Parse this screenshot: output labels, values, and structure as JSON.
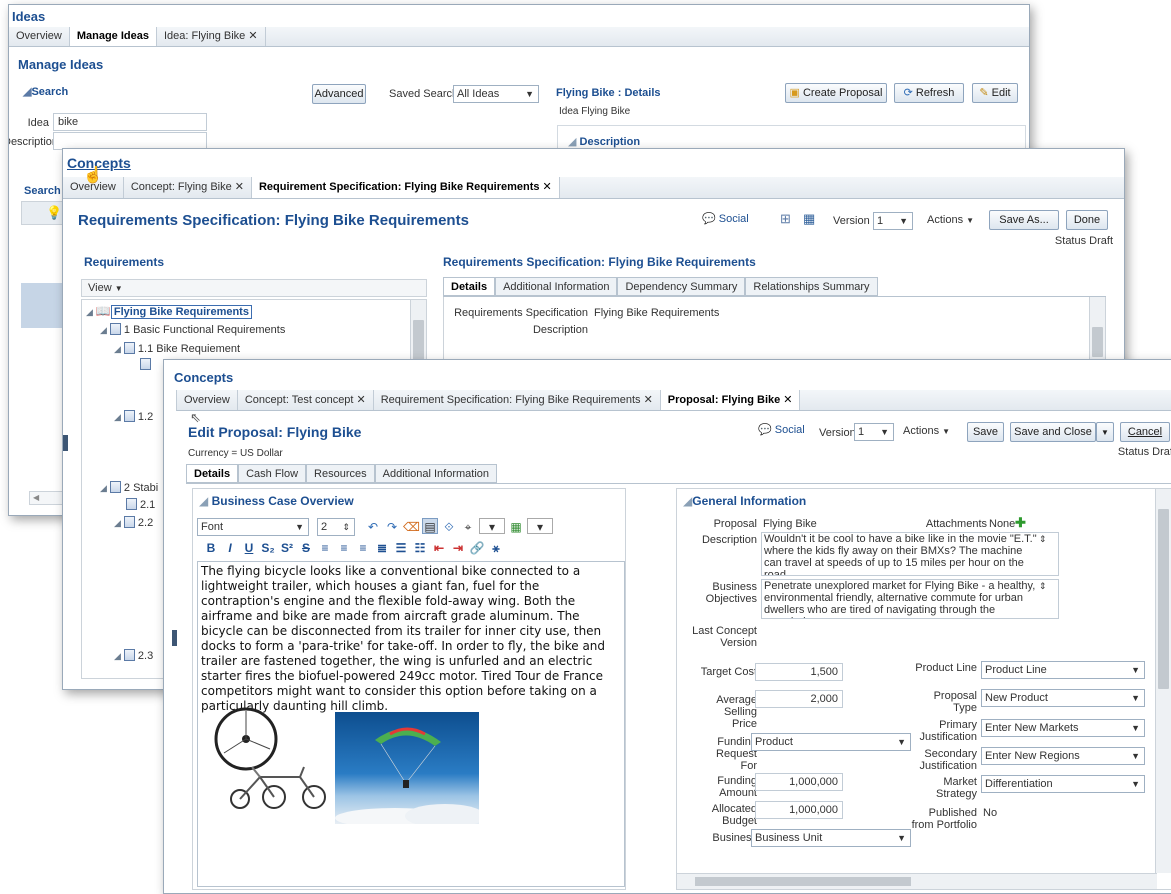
{
  "w1": {
    "title": "Ideas",
    "tabs": [
      "Overview",
      "Manage Ideas",
      "Idea: Flying Bike"
    ],
    "heading": "Manage Ideas",
    "search_label": "Search",
    "advanced": "Advanced",
    "saved_search_label": "Saved Search",
    "saved_search_value": "All Ideas",
    "idea_label": "Idea",
    "idea_value": "bike",
    "description_label": "Description",
    "details_title": "Flying Bike : Details",
    "create_proposal": "Create Proposal",
    "refresh": "Refresh",
    "edit": "Edit",
    "idea_line": "Idea  Flying Bike",
    "desc_section": "Description",
    "search_cut": "Search"
  },
  "w2": {
    "title": "Concepts",
    "tabs": [
      "Overview",
      "Concept: Flying Bike",
      "Requirement Specification: Flying Bike Requirements"
    ],
    "heading": "Requirements Specification: Flying Bike Requirements",
    "social": "Social",
    "version_label": "Version",
    "version_value": "1",
    "actions": "Actions",
    "save_as": "Save As...",
    "done": "Done",
    "status": "Status  Draft",
    "req_header": "Requirements",
    "view": "View",
    "tree": [
      {
        "label": "Flying Bike Requirements",
        "level": 0
      },
      {
        "label": "1 Basic Functional Requirements",
        "level": 1
      },
      {
        "label": "1.1 Bike Requiement",
        "level": 2
      },
      {
        "label": "1.2",
        "level": 2
      },
      {
        "label": "2 Stabi",
        "level": 1
      },
      {
        "label": "2.1",
        "level": 2
      },
      {
        "label": "2.2",
        "level": 2
      },
      {
        "label": "2.3",
        "level": 2
      }
    ],
    "spec_header": "Requirements Specification: Flying Bike Requirements",
    "detail_tabs": [
      "Details",
      "Additional Information",
      "Dependency Summary",
      "Relationships Summary"
    ],
    "spec_label": "Requirements Specification",
    "spec_value": "Flying Bike Requirements",
    "desc_label": "Description"
  },
  "w3": {
    "title": "Concepts",
    "tabs": [
      "Overview",
      "Concept: Test concept",
      "Requirement Specification: Flying Bike Requirements",
      "Proposal: Flying Bike"
    ],
    "heading": "Edit Proposal: Flying Bike",
    "currency": "Currency = US Dollar",
    "social": "Social",
    "version_label": "Version",
    "version_value": "1",
    "actions": "Actions",
    "save": "Save",
    "save_close": "Save and Close",
    "cancel": "Cancel",
    "status": "Status  Draft",
    "sub_tabs": [
      "Details",
      "Cash Flow",
      "Resources",
      "Additional Information"
    ],
    "bco_header": "Business Case Overview",
    "font": "Font",
    "font_size": "2",
    "body_text": "The flying bicycle looks like a conventional bike connected to a lightweight trailer, which houses a giant fan, fuel for the contraption's engine and the flexible fold-away wing. Both the airframe and bike are made from aircraft grade aluminum.  The bicycle can be disconnected from its trailer for inner city use, then docks to form a 'para-trike' for take-off. In order to fly, the bike and trailer are fastened together, the wing is unfurled and an electric starter fires the biofuel-powered 249cc motor. Tired Tour de France competitors might want to consider this option before taking on a particularly daunting hill climb.",
    "gi_header": "General Information",
    "proposal_label": "Proposal",
    "proposal_value": "Flying Bike",
    "attachments_label": "Attachments",
    "attachments_value": "None",
    "description_label": "Description",
    "description_value": "Wouldn't it be cool to have a bike like in the movie \"E.T.\" where the kids fly away on their BMXs?  The machine can travel at speeds of up to 15 miles per hour on the road",
    "objectives_label": "Business Objectives",
    "objectives_value": "Penetrate unexplored market for Flying Bike - a healthy, environmental friendly, alternative commute for urban dwellers who are tired of navigating through the crowded",
    "last_concept_label": "Last Concept Version",
    "target_cost_label": "Target Cost",
    "target_cost": "1,500",
    "avg_price_label": "Average Selling Price",
    "avg_price": "2,000",
    "funding_req_label": "Funding Request For",
    "funding_req": "Product",
    "funding_amt_label": "Funding Amount",
    "funding_amt": "1,000,000",
    "alloc_label": "Allocated Budget",
    "alloc": "1,000,000",
    "business_label": "Business",
    "business": "Business Unit",
    "product_line_label": "Product Line",
    "product_line": "Product Line",
    "proposal_type_label": "Proposal Type",
    "proposal_type": "New Product",
    "primary_label": "Primary Justification",
    "primary": "Enter New Markets",
    "secondary_label": "Secondary Justification",
    "secondary": "Enter New Regions",
    "market_label": "Market Strategy",
    "market": "Differentiation",
    "published_label": "Published from Portfolio",
    "published": "No"
  }
}
